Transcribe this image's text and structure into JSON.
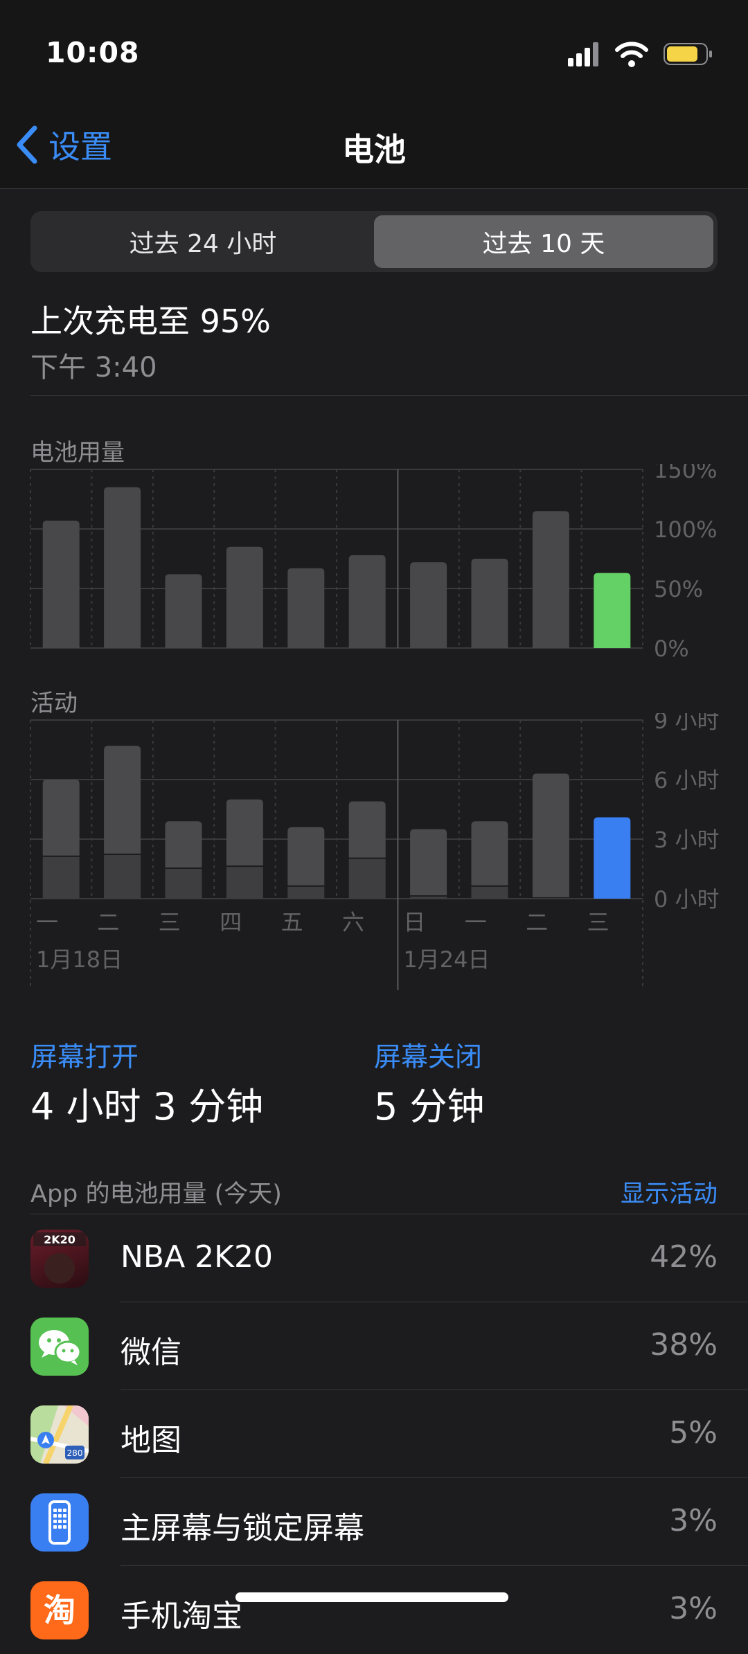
{
  "status": {
    "time": "10:08"
  },
  "nav": {
    "back_label": "设置",
    "title": "电池"
  },
  "segments": {
    "left": "过去 24 小时",
    "right": "过去 10 天",
    "selected": "right"
  },
  "last_charge": {
    "label": "上次充电至 95%",
    "time": "下午 3:40"
  },
  "battery_chart": {
    "label": "电池用量",
    "ticks": [
      "150%",
      "100%",
      "50%",
      "0%"
    ]
  },
  "activity_chart": {
    "label": "活动",
    "ticks": [
      "9 小时",
      "6 小时",
      "3 小时",
      "0 小时"
    ],
    "day_labels": [
      "一",
      "二",
      "三",
      "四",
      "五",
      "六",
      "日",
      "一",
      "二",
      "三"
    ],
    "date_labels": [
      "1月18日",
      "1月24日"
    ]
  },
  "chart_data": [
    {
      "type": "bar",
      "title": "电池用量",
      "categories": [
        "一",
        "二",
        "三",
        "四",
        "五",
        "六",
        "日",
        "一",
        "二",
        "三"
      ],
      "values": [
        107,
        135,
        62,
        85,
        67,
        78,
        72,
        75,
        115,
        63
      ],
      "ylim": [
        0,
        150
      ],
      "highlight_index": 9,
      "highlight_color": "#63d165",
      "bar_color": "#48484a"
    },
    {
      "type": "bar",
      "title": "活动",
      "categories": [
        "一",
        "二",
        "三",
        "四",
        "五",
        "六",
        "日",
        "一",
        "二",
        "三"
      ],
      "series": [
        {
          "values": [
            3.9,
            5.5,
            2.4,
            3.4,
            3.0,
            2.9,
            3.4,
            3.3,
            6.3,
            4.1
          ]
        },
        {
          "values": [
            2.1,
            2.2,
            1.5,
            1.6,
            0.6,
            2.0,
            0.1,
            0.6,
            0.0,
            0.0
          ]
        }
      ],
      "ylim": [
        0,
        9
      ],
      "highlight_index": 9,
      "highlight_color": "#3a7ff2",
      "bar_color": "#48484a"
    }
  ],
  "screen": {
    "on_label": "屏幕打开",
    "on_value": "4 小时 3 分钟",
    "off_label": "屏幕关闭",
    "off_value": "5 分钟"
  },
  "app_usage": {
    "header": "App 的电池用量 (今天)",
    "show_activity": "显示活动",
    "apps": [
      {
        "name": "NBA 2K20",
        "pct": "42%",
        "icon": "nba-2k20-icon",
        "logo_text": "2K20"
      },
      {
        "name": "微信",
        "pct": "38%",
        "icon": "wechat-icon"
      },
      {
        "name": "地图",
        "pct": "5%",
        "icon": "maps-icon",
        "logo_text": "280"
      },
      {
        "name": "主屏幕与锁定屏幕",
        "pct": "3%",
        "icon": "home-lock-screen-icon"
      },
      {
        "name": "手机淘宝",
        "pct": "3%",
        "icon": "taobao-icon",
        "logo_text": "淘"
      }
    ]
  },
  "colors": {
    "accent": "#3a8cf7",
    "battery_green": "#63d165",
    "activity_blue": "#3a7ff2",
    "battery_icon": "#f5d547"
  }
}
